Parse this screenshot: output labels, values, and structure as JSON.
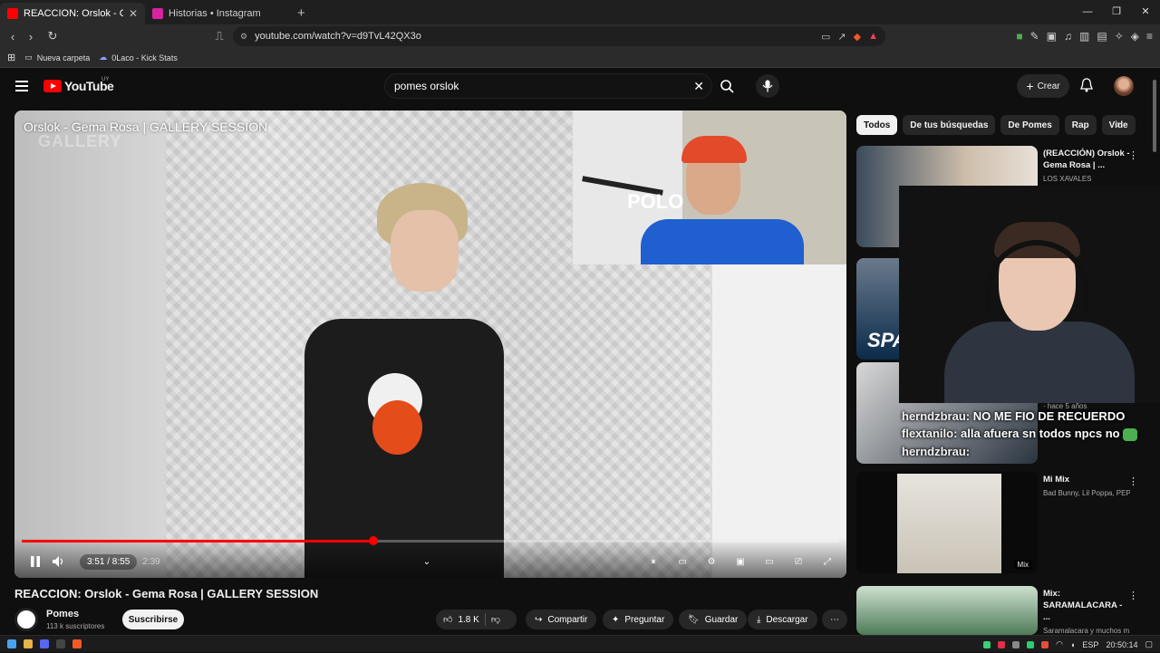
{
  "browser": {
    "tabs": [
      {
        "title": "REACCION: Orslok - Gema Ro",
        "active": true,
        "favicon_color": "#ff0000"
      },
      {
        "title": "Historias • Instagram",
        "active": false,
        "favicon_color": "#d6249f"
      }
    ],
    "new_tab_glyph": "+",
    "url": "youtube.com/watch?v=d9TvL42QX3o",
    "bookmarks": [
      {
        "label": "Nueva carpeta",
        "icon": "folder-icon"
      },
      {
        "label": "0Laco - Kick Stats",
        "icon": "kick-icon"
      }
    ]
  },
  "youtube": {
    "logo_text": "YouTube",
    "region": "UY",
    "search_query": "pomes orslok",
    "create_label": "Crear"
  },
  "player": {
    "overlay_title": "Orslok - Gema Rosa | GALLERY SESSION",
    "watermark": "GALLERY",
    "time_display": "3:51 / 8:55",
    "inner_time": "2:39",
    "progress_fraction": 0.43,
    "buffer_fraction": 0.52,
    "cam_shirt_text": "POLO"
  },
  "video": {
    "title": "REACCION: Orslok - Gema Rosa | GALLERY SESSION",
    "channel": "Pomes",
    "subscribers": "113 k suscriptores",
    "subscribe_label": "Suscribirse",
    "likes": "1.8 K",
    "share_label": "Compartir",
    "ask_label": "Preguntar",
    "save_label": "Guardar",
    "download_label": "Descargar"
  },
  "chips": [
    "Todos",
    "De tus búsquedas",
    "De Pomes",
    "Rap",
    "Vide"
  ],
  "recommendations": [
    {
      "title": "(REACCIÓN) Orslok - Gema Rosa | ...",
      "sub": "LOS XAVALES"
    },
    {
      "title": "",
      "sub": ""
    },
    {
      "title": "",
      "sub": "· hace 5 años"
    },
    {
      "title": "Mi Mix",
      "sub": "Bad Bunny, Lil Poppa, PEPU...",
      "badge": "Mix"
    },
    {
      "title": "Mix: SARAMALACARA - ...",
      "sub": "Saramalacara y muchos m..."
    }
  ],
  "chat": [
    {
      "user": "herndzbrau:",
      "text": "NO ME FIO DE RECUERDO"
    },
    {
      "user": "flextanilo:",
      "text": "alla afuera sn todos npcs no"
    },
    {
      "user": "herndzbrau:",
      "text": ""
    }
  ],
  "taskbar": {
    "lang": "ESP",
    "clock": "20:50:14"
  },
  "colors": {
    "accent": "#ff0000",
    "background": "#0f0f0f"
  }
}
